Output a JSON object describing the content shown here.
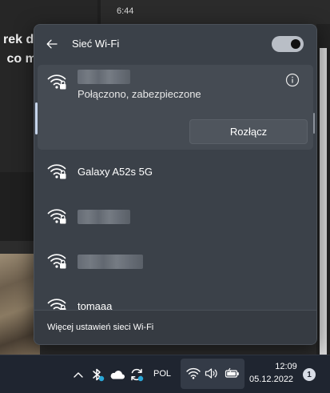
{
  "background": {
    "clock": "6:44",
    "headline": "rek d\n co m"
  },
  "flyout": {
    "title": "Sieć Wi-Fi",
    "wifi_enabled": true,
    "connected_network": {
      "status": "Połączono, zabezpieczone",
      "disconnect_label": "Rozłącz"
    },
    "networks": [
      {
        "name": "Galaxy A52s 5G",
        "secured": true
      },
      {
        "name": "",
        "secured": true
      },
      {
        "name": "",
        "secured": true
      },
      {
        "name": "tomaaa",
        "secured": true
      }
    ],
    "footer_link": "Więcej ustawień sieci Wi-Fi"
  },
  "taskbar": {
    "language": "POL",
    "time": "12:09",
    "date": "05.12.2022",
    "notification_count": "1",
    "icons": [
      "chevron-up-icon",
      "bluetooth-icon",
      "onedrive-cloud-icon",
      "sync-icon",
      "wifi-icon",
      "speaker-icon",
      "battery-icon"
    ]
  },
  "colors": {
    "flyout_bg": "#3b4149",
    "accent_indicator": "#c6d4ea",
    "taskbar_bg": "#1f2530"
  }
}
